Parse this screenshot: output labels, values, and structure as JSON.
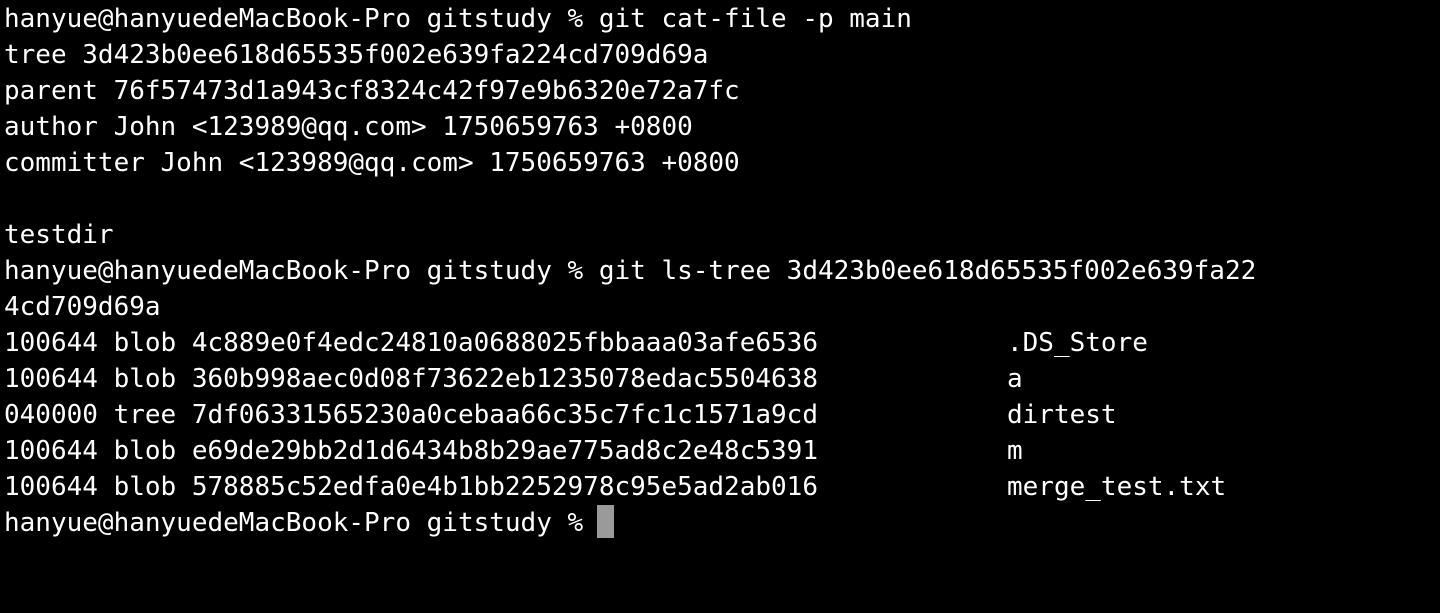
{
  "terminal": {
    "lines": {
      "cmd1": "hanyue@hanyuedeMacBook-Pro gitstudy % git cat-file -p main",
      "tree": "tree 3d423b0ee618d65535f002e639fa224cd709d69a",
      "parent": "parent 76f57473d1a943cf8324c42f97e9b6320e72a7fc",
      "author": "author John <123989@qq.com> 1750659763 +0800",
      "committer": "committer John <123989@qq.com> 1750659763 +0800",
      "message": "testdir",
      "cmd2": "hanyue@hanyuedeMacBook-Pro gitstudy % git ls-tree 3d423b0ee618d65535f002e639fa22",
      "cmd2_wrap": "4cd709d69a",
      "prompt": "hanyue@hanyuedeMacBook-Pro gitstudy %"
    },
    "tree_entries": [
      {
        "meta": "100644 blob 4c889e0f4edc24810a0688025fbbaaa03afe6536",
        "name": ".DS_Store"
      },
      {
        "meta": "100644 blob 360b998aec0d08f73622eb1235078edac5504638",
        "name": "a"
      },
      {
        "meta": "040000 tree 7df06331565230a0cebaa66c35c7fc1c1571a9cd",
        "name": "dirtest"
      },
      {
        "meta": "100644 blob e69de29bb2d1d6434b8b29ae775ad8c2e48c5391",
        "name": "m"
      },
      {
        "meta": "100644 blob 578885c52edfa0e4b1bb2252978c95e5ad2ab016",
        "name": "merge_test.txt"
      }
    ],
    "colors": {
      "background": "#000000",
      "foreground": "#ffffff",
      "cursor": "#9a9a9a"
    }
  }
}
